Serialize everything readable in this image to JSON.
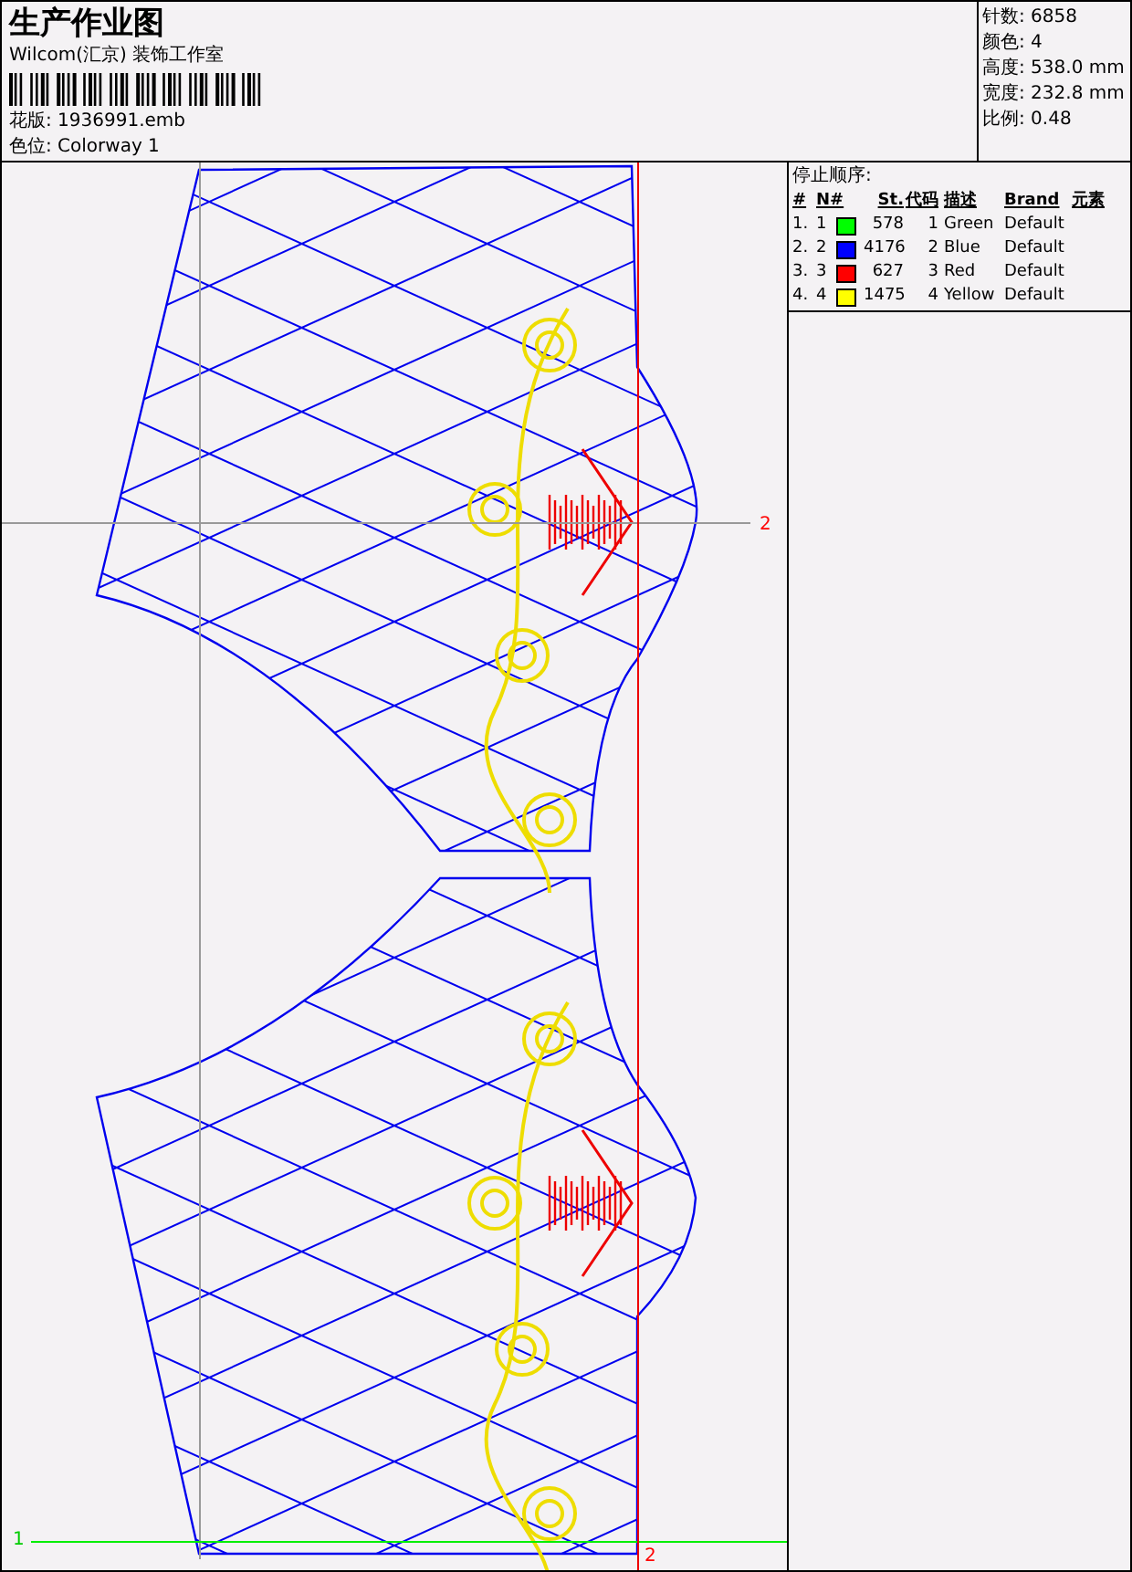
{
  "title": "生产作业图",
  "company": "Wilcom(汇京) 装饰工作室",
  "design_lines": [
    "花版: 1936991.emb",
    "色位: Colorway 1"
  ],
  "stats": [
    "针数: 6858",
    "颜色: 4",
    "高度: 538.0 mm",
    "宽度: 232.8 mm",
    "比例: 0.48"
  ],
  "stop_sequence": {
    "title": "停止顺序:",
    "columns": [
      "#",
      "N#",
      "St.",
      "代码",
      "描述",
      "Brand",
      "元素"
    ],
    "rows": [
      {
        "index": "1.",
        "number": "1",
        "color": "#00ff00",
        "stitches": "578",
        "code": "1",
        "description": "Green",
        "brand": "Default"
      },
      {
        "index": "2.",
        "number": "2",
        "color": "#0000ff",
        "stitches": "4176",
        "code": "2",
        "description": "Blue",
        "brand": "Default"
      },
      {
        "index": "3.",
        "number": "3",
        "color": "#ff0000",
        "stitches": "627",
        "code": "3",
        "description": "Red",
        "brand": "Default"
      },
      {
        "index": "4.",
        "number": "4",
        "color": "#ffff00",
        "stitches": "1475",
        "code": "4",
        "description": "Yellow",
        "brand": "Default"
      }
    ]
  },
  "canvas": {
    "markers": [
      {
        "text": "2",
        "color": "#ff0000"
      },
      {
        "text": "1",
        "color": "#00cc00"
      },
      {
        "text": "2",
        "color": "#ff0000"
      }
    ]
  }
}
